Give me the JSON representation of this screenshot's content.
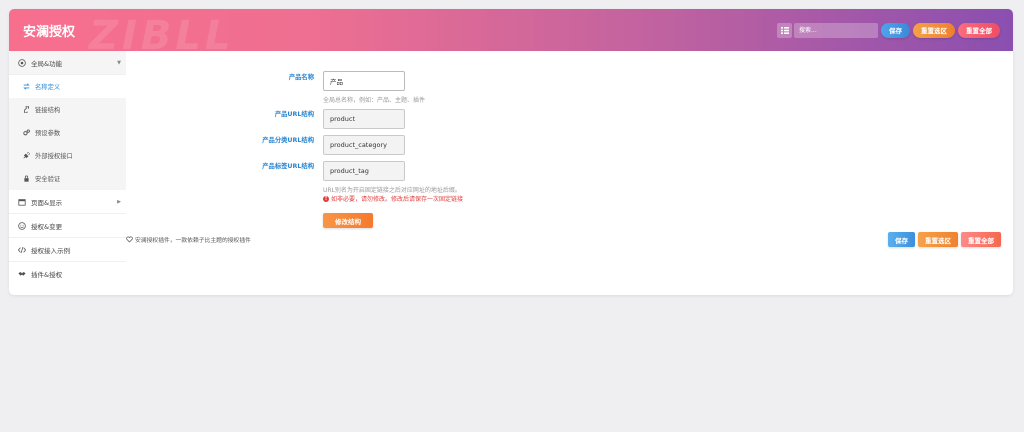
{
  "header": {
    "title": "安澜授权",
    "watermark": "ZIBLL",
    "search_placeholder": "搜索...",
    "save_label": "保存",
    "reset_section_label": "重置选区",
    "reset_all_label": "重置全部"
  },
  "colors": {
    "accent": "#2b84d0",
    "warning": "#e03c3c",
    "submit": "#f47a2e"
  },
  "sidebar": {
    "items": [
      {
        "label": "全局&功能",
        "icon": "globe-icon",
        "expanded": true,
        "children": [
          {
            "label": "名称定义",
            "icon": "swap-icon",
            "active": true
          },
          {
            "label": "链接结构",
            "icon": "link-icon"
          },
          {
            "label": "预设参数",
            "icon": "gears-icon"
          },
          {
            "label": "外部授权接口",
            "icon": "plug-icon"
          },
          {
            "label": "安全验证",
            "icon": "lock-icon"
          }
        ]
      },
      {
        "label": "页面&显示",
        "icon": "calendar-icon"
      },
      {
        "label": "授权&变更",
        "icon": "smile-icon"
      },
      {
        "label": "授权接入示例",
        "icon": "code-icon"
      },
      {
        "label": "插件&授权",
        "icon": "handshake-icon"
      }
    ]
  },
  "form": {
    "product_name_label": "产品名称",
    "product_name_value": "产品",
    "product_name_hint": "全局总名称，例如：产品、主题、插件",
    "product_url_label": "产品URL结构",
    "product_url_value": "product",
    "category_url_label": "产品分类URL结构",
    "category_url_value": "product_category",
    "tag_url_label": "产品标签URL结构",
    "tag_url_value": "product_tag",
    "url_hint": "URL别名为开启固定链接之后对应网址的地址后缀。",
    "url_warning": "如非必要，请勿修改。修改后请保存一次固定链接",
    "submit_label": "修改结构"
  },
  "footer": {
    "note": "安澜授权插件，一款依赖子比主题的授权插件",
    "save_label": "保存",
    "reset_section_label": "重置选区",
    "reset_all_label": "重置全部"
  }
}
